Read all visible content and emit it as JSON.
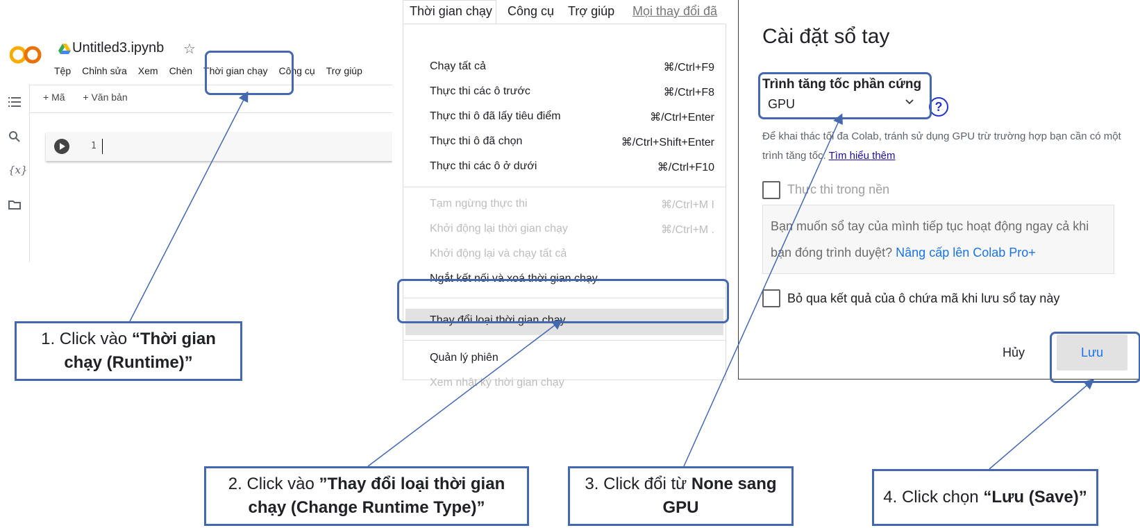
{
  "colab": {
    "logo_text": "CO",
    "notebook_title": "Untitled3.ipynb",
    "menu": [
      "Tệp",
      "Chỉnh sửa",
      "Xem",
      "Chèn",
      "Thời gian chạy",
      "Công cụ",
      "Trợ giúp"
    ],
    "toolbar": {
      "add_code": "+ Mã",
      "add_text": "+ Văn bản"
    },
    "cell_line_number": "1",
    "sidebar_icons": [
      "list-icon",
      "search-icon",
      "variables-icon",
      "folder-icon"
    ],
    "variables_glyph": "{x}"
  },
  "runtime_menu": {
    "menubar": [
      "Thời gian chạy",
      "Công cụ",
      "Trợ giúp",
      "Mọi thay đổi đã"
    ],
    "items": [
      {
        "label": "Chạy tất cả",
        "shortcut": "⌘/Ctrl+F9",
        "disabled": false
      },
      {
        "label": "Thực thi các ô trước",
        "shortcut": "⌘/Ctrl+F8",
        "disabled": false
      },
      {
        "label": "Thực thi ô đã lấy tiêu điểm",
        "shortcut": "⌘/Ctrl+Enter",
        "disabled": false
      },
      {
        "label": "Thực thi ô đã chọn",
        "shortcut": "⌘/Ctrl+Shift+Enter",
        "disabled": false
      },
      {
        "label": "Thực thi các ô ở dưới",
        "shortcut": "⌘/Ctrl+F10",
        "disabled": false
      },
      {
        "label": "Tạm ngừng thực thi",
        "shortcut": "⌘/Ctrl+M I",
        "disabled": true
      },
      {
        "label": "Khởi động lại thời gian chạy",
        "shortcut": "⌘/Ctrl+M .",
        "disabled": true
      },
      {
        "label": "Khởi động lại và chạy tất cả",
        "shortcut": "",
        "disabled": true
      },
      {
        "label": "Ngắt kết nối và xoá thời gian chạy",
        "shortcut": "",
        "disabled": false
      },
      {
        "label": "Thay đổi loại thời gian chạy",
        "shortcut": "",
        "disabled": false
      },
      {
        "label": "Quản lý phiên",
        "shortcut": "",
        "disabled": false
      },
      {
        "label": "Xem nhật ký thời gian chạy",
        "shortcut": "",
        "disabled": true
      }
    ]
  },
  "settings_dialog": {
    "title": "Cài đặt sổ tay",
    "accelerator_label": "Trình tăng tốc phần cứng",
    "accelerator_value": "GPU",
    "help_glyph": "?",
    "description": "Để khai thác tối đa Colab, tránh sử dụng GPU trừ trường hợp bạn cần có một trình tăng tốc.",
    "learn_more": "Tìm hiểu thêm",
    "background_exec_label": "Thực thi trong nền",
    "background_exec_checked": false,
    "upsell_text": "Bạn muốn sổ tay của mình tiếp tục hoạt động ngay cả khi bạn đóng trình duyệt?",
    "upsell_link": "Nâng cấp lên Colab Pro+",
    "omit_output_label": "Bỏ qua kết quả của ô chứa mã khi lưu sổ tay này",
    "omit_output_checked": false,
    "cancel": "Hủy",
    "save": "Lưu"
  },
  "callouts": {
    "step1": {
      "prefix": "1. Click vào ",
      "bold": "“Thời gian chạy (Runtime)”"
    },
    "step2": {
      "prefix": "2. Click vào ",
      "bold": "”Thay đổi loại thời gian chạy (Change Runtime Type)”"
    },
    "step3": {
      "prefix": "3. Click đổi từ ",
      "bold": "None sang GPU"
    },
    "step4": {
      "prefix": "4. Click chọn ",
      "bold": "“Lưu (Save)”"
    }
  },
  "colors": {
    "highlight": "#4468b0",
    "link": "#1a73e8",
    "orange": "#f9ab00"
  }
}
